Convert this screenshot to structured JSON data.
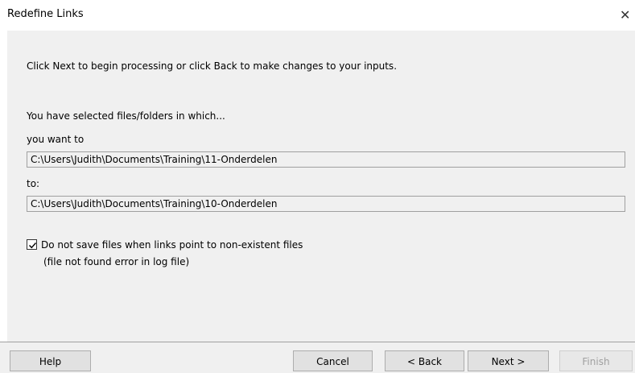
{
  "window": {
    "title": "Redefine Links",
    "close_glyph": "✕"
  },
  "main": {
    "instruction": "Click Next to begin processing or click Back to make changes to your inputs.",
    "selected_label": "You have selected files/folders in which...",
    "want_to_label": "you want to",
    "from_path": "C:\\Users\\Judith\\Documents\\Training\\11-Onderdelen",
    "to_label": "to:",
    "to_path": "C:\\Users\\Judith\\Documents\\Training\\10-Onderdelen",
    "checkbox_checked": true,
    "checkbox_label": "Do not save files when links point to non-existent files",
    "checkbox_sublabel": "(file not found error in log file)"
  },
  "buttons": {
    "help": "Help",
    "cancel": "Cancel",
    "back": "< Back",
    "next": "Next >",
    "finish": "Finish"
  }
}
